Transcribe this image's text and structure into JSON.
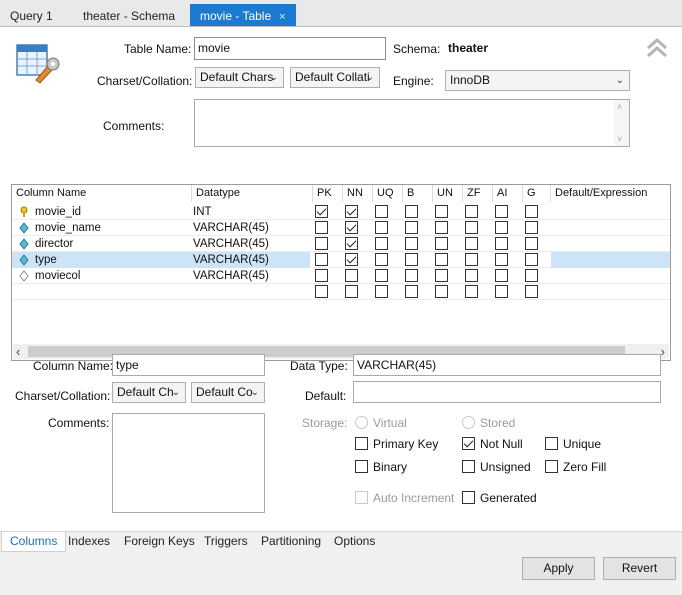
{
  "tabs": [
    {
      "label": "Query 1"
    },
    {
      "label": "theater - Schema"
    },
    {
      "label": "movie - Table",
      "close": "×"
    }
  ],
  "header": {
    "table_name_label": "Table Name:",
    "table_name_value": "movie",
    "schema_label": "Schema:",
    "schema_value": "theater",
    "charset_label": "Charset/Collation:",
    "charset_value": "Default Chars",
    "collation_value": "Default Collati",
    "engine_label": "Engine:",
    "engine_value": "InnoDB",
    "comments_label": "Comments:"
  },
  "grid": {
    "headers": [
      "Column Name",
      "Datatype",
      "PK",
      "NN",
      "UQ",
      "B",
      "UN",
      "ZF",
      "AI",
      "G",
      "Default/Expression"
    ],
    "rows": [
      {
        "name": "movie_id",
        "type": "INT",
        "icon": "key-icon",
        "flags": [
          true,
          true,
          false,
          false,
          false,
          false,
          false,
          false
        ]
      },
      {
        "name": "movie_name",
        "type": "VARCHAR(45)",
        "icon": "diamond-icon",
        "flags": [
          false,
          true,
          false,
          false,
          false,
          false,
          false,
          false
        ]
      },
      {
        "name": "director",
        "type": "VARCHAR(45)",
        "icon": "diamond-icon",
        "flags": [
          false,
          true,
          false,
          false,
          false,
          false,
          false,
          false
        ]
      },
      {
        "name": "type",
        "type": "VARCHAR(45)",
        "icon": "diamond-icon",
        "flags": [
          false,
          true,
          false,
          false,
          false,
          false,
          false,
          false
        ],
        "selected": true
      },
      {
        "name": "moviecol",
        "type": "VARCHAR(45)",
        "icon": "diamond-outline-icon",
        "flags": [
          false,
          false,
          false,
          false,
          false,
          false,
          false,
          false
        ]
      },
      {
        "name": "",
        "type": "",
        "icon": "",
        "flags": [
          false,
          false,
          false,
          false,
          false,
          false,
          false,
          false
        ]
      }
    ],
    "scroll_left": "‹",
    "scroll_right": "›"
  },
  "details": {
    "column_name_label": "Column Name:",
    "column_name_value": "type",
    "charset_label": "Charset/Collation:",
    "charset_value": "Default Ch",
    "collation_value": "Default Co",
    "comments_label": "Comments:",
    "data_type_label": "Data Type:",
    "data_type_value": "VARCHAR(45)",
    "default_label": "Default:",
    "default_value": "",
    "storage_label": "Storage:",
    "virtual_label": "Virtual",
    "stored_label": "Stored",
    "primary_key_label": "Primary Key",
    "not_null_label": "Not Null",
    "unique_label": "Unique",
    "binary_label": "Binary",
    "unsigned_label": "Unsigned",
    "zero_fill_label": "Zero Fill",
    "auto_increment_label": "Auto Increment",
    "generated_label": "Generated"
  },
  "bottom_tabs": [
    "Columns",
    "Indexes",
    "Foreign Keys",
    "Triggers",
    "Partitioning",
    "Options"
  ],
  "buttons": {
    "apply": "Apply",
    "revert": "Revert"
  },
  "colors": {
    "accent": "#1c7bd0",
    "selected_row": "#cde3f7"
  }
}
